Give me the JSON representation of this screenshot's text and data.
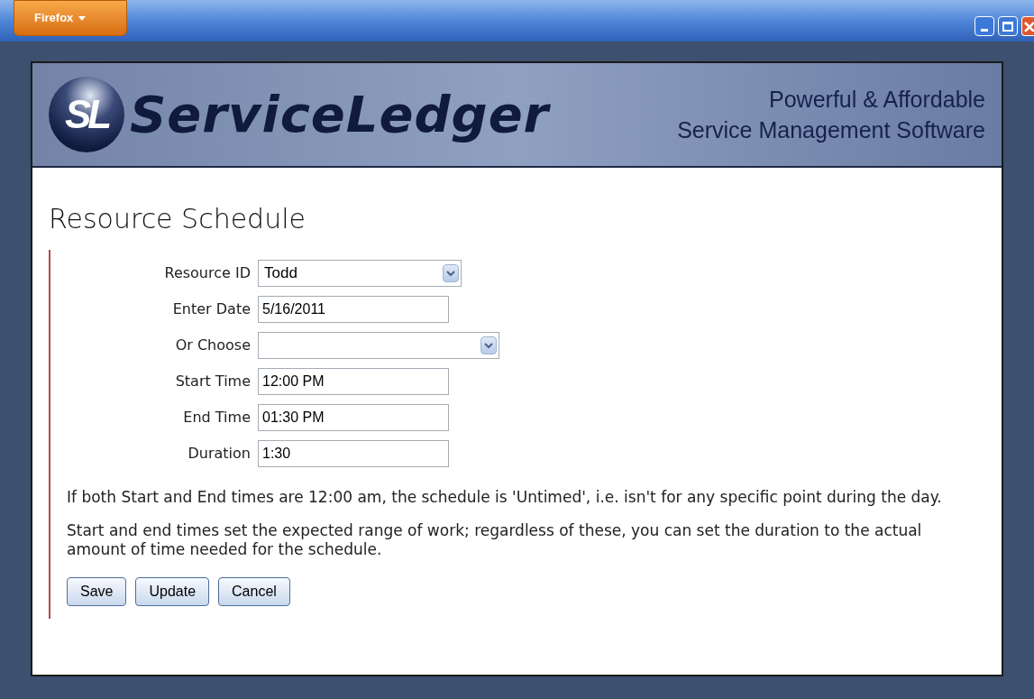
{
  "window": {
    "app_button": "Firefox"
  },
  "banner": {
    "logo_mark": "SL",
    "logo_text": "ServiceLedger",
    "tagline": [
      "Powerful & Affordable",
      "Service Management Software"
    ]
  },
  "page": {
    "title": "Resource Schedule"
  },
  "fields": [
    {
      "label": "Resource ID",
      "kind": "select",
      "value": "Todd"
    },
    {
      "label": "Enter Date",
      "kind": "text",
      "value": "5/16/2011"
    },
    {
      "label": "Or Choose",
      "kind": "dropdown"
    },
    {
      "label": "Start Time",
      "kind": "text",
      "value": "12:00 PM"
    },
    {
      "label": "End Time",
      "kind": "text",
      "value": "01:30 PM"
    },
    {
      "label": "Duration",
      "kind": "text",
      "value": "1:30"
    }
  ],
  "notes": [
    "If both Start and End times are 12:00 am, the schedule is 'Untimed', i.e. isn't for any specific point during the day.",
    "Start and end times set the expected range of work; regardless of these, you can set the duration to the actual amount of time needed for the schedule."
  ],
  "buttons": [
    "Save",
    "Update",
    "Cancel"
  ]
}
